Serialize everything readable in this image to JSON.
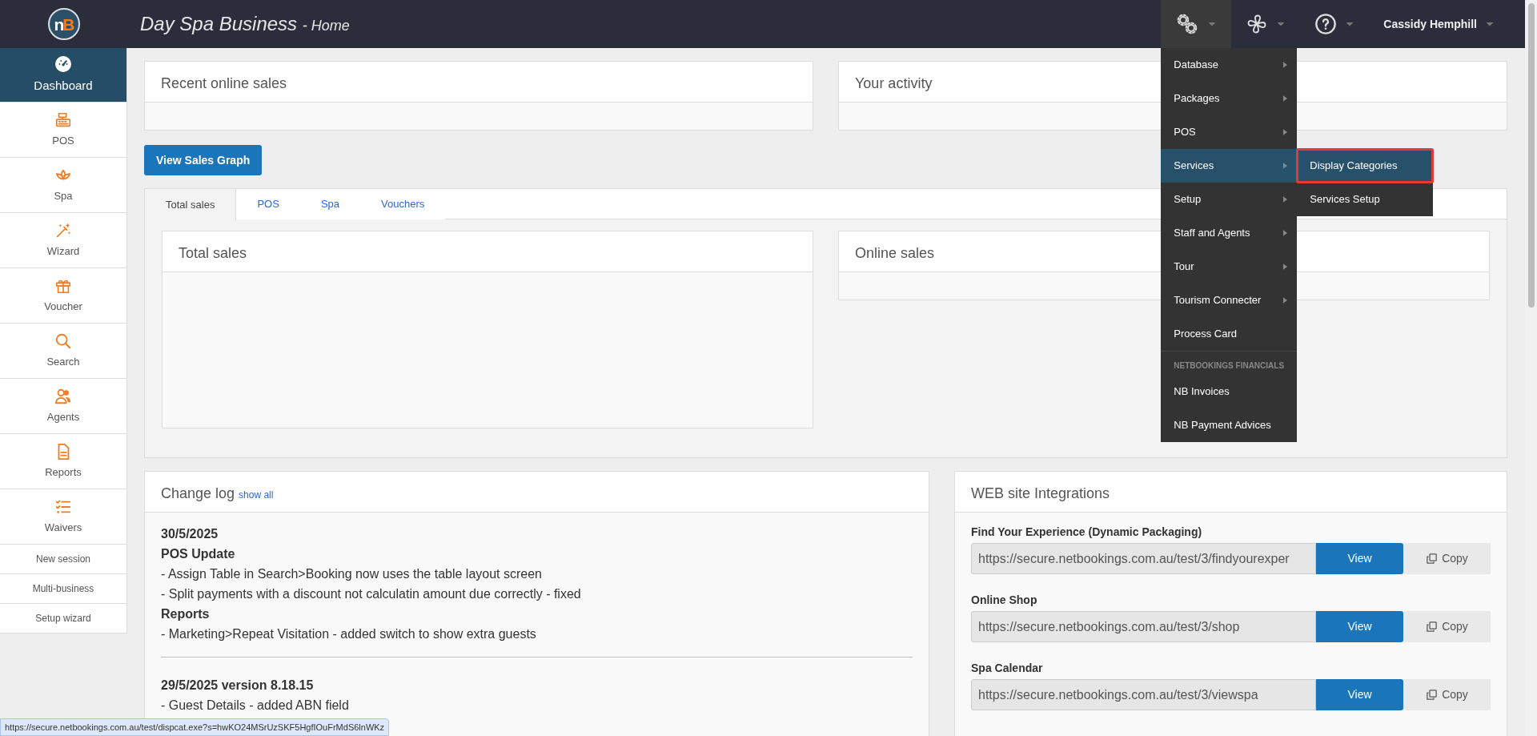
{
  "navbar": {
    "logo": {
      "parts": [
        {
          "text": "n",
          "color": "#ffffff"
        },
        {
          "text": "B",
          "color": "#f07c24"
        }
      ]
    },
    "title": {
      "business": "Day Spa Business",
      "page": "- Home"
    },
    "user_name": "Cassidy Hemphill",
    "settings_open": true
  },
  "settings_menu": [
    {
      "kind": "item",
      "label": "Database",
      "has_submenu": true,
      "expanded": false
    },
    {
      "kind": "item",
      "label": "Packages",
      "has_submenu": true,
      "expanded": false
    },
    {
      "kind": "item",
      "label": "POS",
      "has_submenu": true,
      "expanded": false
    },
    {
      "kind": "item",
      "label": "Services",
      "has_submenu": true,
      "expanded": true,
      "submenu": [
        {
          "label": "Display Categories",
          "selected": true
        },
        {
          "label": "Services Setup",
          "selected": false
        }
      ]
    },
    {
      "kind": "item",
      "label": "Setup",
      "has_submenu": true,
      "expanded": false
    },
    {
      "kind": "item",
      "label": "Staff and Agents",
      "has_submenu": true,
      "expanded": false
    },
    {
      "kind": "item",
      "label": "Tour",
      "has_submenu": true,
      "expanded": false
    },
    {
      "kind": "item",
      "label": "Tourism Connecter",
      "has_submenu": true,
      "expanded": false
    },
    {
      "kind": "item",
      "label": "Process Card",
      "has_submenu": false,
      "expanded": false
    },
    {
      "kind": "header",
      "label": "NETBOOKINGS FINANCIALS"
    },
    {
      "kind": "item",
      "label": "NB Invoices",
      "has_submenu": false,
      "expanded": false
    },
    {
      "kind": "item",
      "label": "NB Payment Advices",
      "has_submenu": false,
      "expanded": false
    }
  ],
  "sidebar": {
    "items": [
      {
        "kind": "icon",
        "label": "Dashboard",
        "selected": true
      },
      {
        "kind": "icon",
        "label": "POS",
        "selected": false
      },
      {
        "kind": "icon",
        "label": "Spa",
        "selected": false
      },
      {
        "kind": "icon",
        "label": "Wizard",
        "selected": false
      },
      {
        "kind": "icon",
        "label": "Voucher",
        "selected": false
      },
      {
        "kind": "icon",
        "label": "Search",
        "selected": false
      },
      {
        "kind": "icon",
        "label": "Agents",
        "selected": false
      },
      {
        "kind": "icon",
        "label": "Reports",
        "selected": false
      },
      {
        "kind": "icon",
        "label": "Waivers",
        "selected": false
      },
      {
        "kind": "link",
        "label": "New session",
        "selected": false
      },
      {
        "kind": "link",
        "label": "Multi-business",
        "selected": false
      },
      {
        "kind": "link",
        "label": "Setup wizard",
        "selected": false
      }
    ]
  },
  "top_cards": [
    {
      "title": "Recent online sales"
    },
    {
      "title": "Your activity"
    }
  ],
  "view_sales_graph_button": "View Sales Graph",
  "sales_tabs": {
    "tabs": [
      {
        "label": "Total sales",
        "selected": true
      },
      {
        "label": "POS",
        "selected": false
      },
      {
        "label": "Spa",
        "selected": false
      },
      {
        "label": "Vouchers",
        "selected": false
      }
    ],
    "cards": [
      {
        "title": "Total sales",
        "tall": true
      },
      {
        "title": "Online sales",
        "tall": false
      }
    ]
  },
  "change_log": {
    "title": "Change log",
    "show_all": "show all",
    "entries": [
      {
        "date": "30/5/2025",
        "sections": [
          {
            "heading": "POS Update",
            "lines": [
              "- Assign Table in Search>Booking now uses the table layout screen",
              "- Split payments with a discount not calculatin amount due correctly - fixed"
            ]
          },
          {
            "heading": "Reports",
            "lines": [
              "- Marketing>Repeat Visitation - added switch to show extra guests"
            ]
          }
        ]
      },
      {
        "date": "29/5/2025 version 8.18.15",
        "sections": [
          {
            "lines": [
              "- Guest Details - added ABN field"
            ]
          }
        ]
      }
    ]
  },
  "web_integrations": {
    "title": "WEB site Integrations",
    "items": [
      {
        "label": "Find Your Experience (Dynamic Packaging)",
        "url": "https://secure.netbookings.com.au/test/3/findyourexper",
        "view": "View",
        "copy": "Copy"
      },
      {
        "label": "Online Shop",
        "url": "https://secure.netbookings.com.au/test/3/shop",
        "view": "View",
        "copy": "Copy"
      },
      {
        "label": "Spa Calendar",
        "url": "https://secure.netbookings.com.au/test/3/viewspa",
        "view": "View",
        "copy": "Copy"
      }
    ]
  },
  "status_bar": {
    "url": "https://secure.netbookings.com.au/test/dispcat.exe?s=hwKO24MSrUzSKF5HgfIOuFrMdS6lnWKz"
  }
}
